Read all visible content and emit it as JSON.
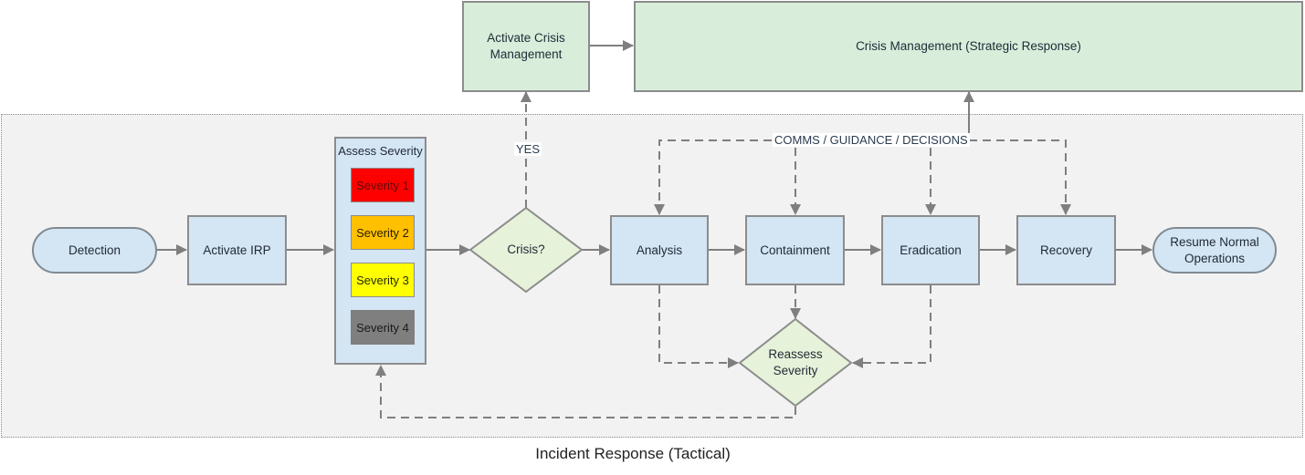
{
  "diagram": {
    "strategic": {
      "activate_crisis": "Activate Crisis Management",
      "crisis_management": "Crisis Management (Strategic Response)"
    },
    "tactical": {
      "zone_label": "Incident Response (Tactical)",
      "detection": "Detection",
      "activate_irp": "Activate IRP",
      "assess_severity": {
        "title": "Assess Severity",
        "levels": [
          {
            "label": "Severity 1",
            "color": "#ff0000",
            "text_color": "#5a0a0a"
          },
          {
            "label": "Severity 2",
            "color": "#ffc000",
            "text_color": "#2a2000"
          },
          {
            "label": "Severity 3",
            "color": "#ffff00",
            "text_color": "#2a2a00"
          },
          {
            "label": "Severity 4",
            "color": "#7f7f7f",
            "text_color": "#1a1a1a"
          }
        ]
      },
      "crisis_decision": "Crisis?",
      "yes_label": "YES",
      "analysis": "Analysis",
      "containment": "Containment",
      "eradication": "Eradication",
      "recovery": "Recovery",
      "resume": "Resume Normal Operations",
      "reassess": "Reassess Severity",
      "comms_label": "COMMS / GUIDANCE / DECISIONS"
    },
    "colors": {
      "process_fill": "#d4e5f3",
      "decision_fill": "#e6f2d9",
      "strategic_fill": "#d8eedb",
      "zone_fill": "#f2f2f2",
      "connector": "#7f7f7f"
    }
  }
}
